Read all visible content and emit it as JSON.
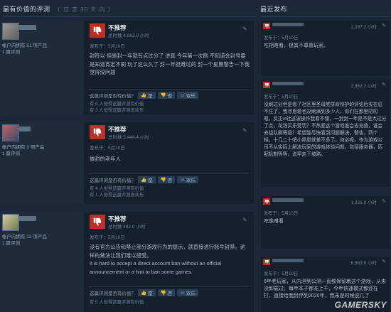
{
  "left_section": {
    "title": "最有价值的评测",
    "subtitle": "（ 过 去 30 天 内 ）"
  },
  "right_section": {
    "title": "最近发布"
  },
  "colors": {
    "thumb_down": "#b83028",
    "bg": "#1b2838",
    "panel": "#16202d"
  },
  "reviews": [
    {
      "user_products": "帐户内拥有 51 项产品",
      "user_reviews": "1 篇评测",
      "verdict": "不推荐",
      "hours": "总时数 4,862.0 小时",
      "posted": "发布于：5月10日",
      "text": "封符以 但是封一年就有点过分了 讲真 今年第一次刷 不知道会封号要是知道肯定不刷 玩了这么久了 封一年挺难过的 封一个星期警告一下我觉得没问题",
      "helpful_q": "这篇评测是否有价值？",
      "yes": "是",
      "no": "否",
      "funny": "欢乐",
      "foot1": "有 8 人觉得这篇评测有价值",
      "foot2": "有 3 人觉得这篇评测很欢乐"
    },
    {
      "user_products": "帐户内拥有 3 项产品",
      "user_reviews": "1 篇评测",
      "verdict": "不推荐",
      "hours": "总时数 3,444.4 小时",
      "posted": "发布于：5月10日",
      "text": "被封的老年人",
      "helpful_q": "这篇评测是否有价值？",
      "yes": "是",
      "no": "否",
      "funny": "欢乐",
      "foot1": "有 4 人觉得这篇评测有价值",
      "foot2": "有 1 人觉得这篇评测很欢乐"
    },
    {
      "user_products": "帐户内拥有 12 项产品",
      "user_reviews": "1 篇评测",
      "verdict": "不推荐",
      "hours": "总时数 482.0 小时",
      "posted": "发布于：5月10日",
      "text": "没有官方公告和禁止部分游戏行为的提示，就直接进行账号封禁，这样的做法让我们难以接受。",
      "text_en": "It is hard to accept a direct account ban without an official announcement or a hint to ban some games.",
      "helpful_q": "这篇评测是否有价值？",
      "yes": "是",
      "no": "否",
      "funny": "欢乐",
      "foot1": "有 5 人觉得这篇评测有价值"
    }
  ],
  "recent": [
    {
      "hours": "2,297.2 小时",
      "posted": "发布于：5月10日",
      "text": "吃相难看，极其不尊重玩家。"
    },
    {
      "hours": "2,962.2 小时",
      "posted": "发布于：5月10日",
      "text": "没刷过分但是看了社区里圣母党拼命辩护的评论后实在忍不住了，我寻思着也没刷满到多少人，你们在那里叨叨嗯。反正vt社这波操作我看不懂，一封封一年是不是大过分了点，花钱买乐受罚？不热爱这个游戏谁会去充值，谁会去组队刷等级？希望能尽快看到问题解决，警告，四个档，十几二十吧小黑屋就差不多了，何必呢。作为游戏公司不从实际上解决玩家的游戏体验问题，包括服务器，匹配机制等等，说早走下坡路。"
    },
    {
      "hours": "1,221.9 小时",
      "posted": "发布于：5月10日",
      "text": "吃像难看"
    },
    {
      "hours": "6,563.8 小时",
      "posted": "发布于：5月10日",
      "text": "6年老玩家，从内测到公测一直都保留着这个游戏，从来没卸载过，每年本子都充上千，今年快速模式都还在打，直接给我封停到2020年，我未是时候说几了"
    }
  ],
  "watermark": "GAMERSKY"
}
